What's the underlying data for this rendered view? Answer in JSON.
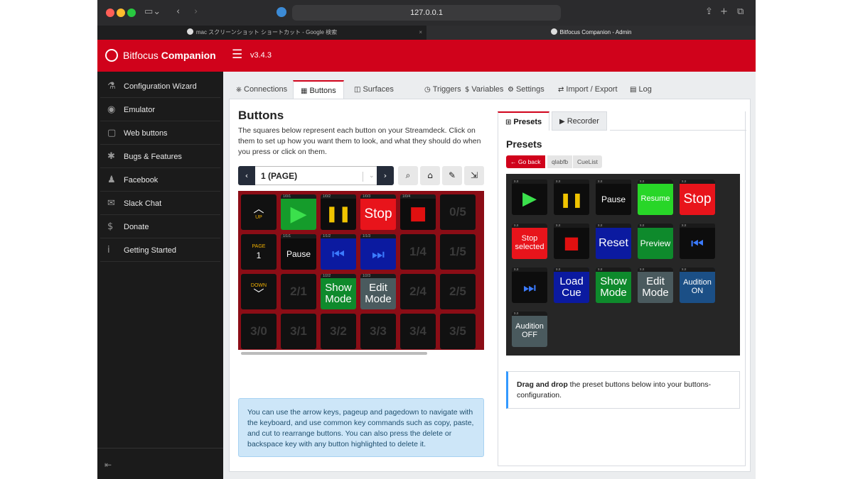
{
  "browser": {
    "address": "127.0.0.1",
    "tabs": [
      {
        "label": "mac スクリーンショット ショートカット - Google 検索",
        "active": false
      },
      {
        "label": "Bitfocus Companion - Admin",
        "active": true
      }
    ]
  },
  "app": {
    "brand_a": "Bitfocus",
    "brand_b": "Companion",
    "version": "v3.4.3"
  },
  "sidebar": {
    "items": [
      {
        "label": "Configuration Wizard",
        "icon": "wizard-hat-icon",
        "glyph": "⚗"
      },
      {
        "label": "Emulator",
        "icon": "gamepad-icon",
        "glyph": "◉"
      },
      {
        "label": "Web buttons",
        "icon": "tablet-icon",
        "glyph": "▢"
      },
      {
        "label": "Bugs & Features",
        "icon": "bug-icon",
        "glyph": "✱"
      },
      {
        "label": "Facebook",
        "icon": "users-icon",
        "glyph": "♟"
      },
      {
        "label": "Slack Chat",
        "icon": "comments-icon",
        "glyph": "✉"
      },
      {
        "label": "Donate",
        "icon": "dollar-icon",
        "glyph": "$"
      },
      {
        "label": "Getting Started",
        "icon": "info-icon",
        "glyph": "i"
      }
    ]
  },
  "tabs": [
    {
      "label": "Connections",
      "glyph": "⎈",
      "active": false
    },
    {
      "label": "Buttons",
      "glyph": "▦",
      "active": true
    },
    {
      "label": "Surfaces",
      "glyph": "◫",
      "active": false
    },
    {
      "label": "Triggers",
      "glyph": "◷",
      "active": false
    },
    {
      "label": "Variables",
      "glyph": "$",
      "active": false
    },
    {
      "label": "Settings",
      "glyph": "⚙",
      "active": false
    },
    {
      "label": "Import / Export",
      "glyph": "⇄",
      "active": false
    },
    {
      "label": "Log",
      "glyph": "▤",
      "active": false
    }
  ],
  "buttons": {
    "title": "Buttons",
    "description": "The squares below represent each button on your Streamdeck. Click on them to set up how you want them to look, and what they should do when you press or click on them.",
    "page_label": "1 (PAGE)",
    "help": "You can use the arrow keys, pageup and pagedown to navigate with the keyboard, and use common key commands such as copy, paste, and cut to rearrange buttons. You can also press the delete or backspace key with any button highlighted to delete it.",
    "grid": [
      [
        {
          "type": "nav",
          "label": "UP",
          "arrow": "︿"
        },
        {
          "header": "1/0/1",
          "label": "▶",
          "kind": "play",
          "bg": "#159c2b",
          "fg": "#3be04c"
        },
        {
          "header": "1/0/2",
          "label": "❚❚",
          "kind": "pause",
          "bg": "#0d0d0d",
          "fg": "#f0c400"
        },
        {
          "header": "1/0/3",
          "label": "Stop",
          "kind": "text",
          "bg": "#e8141b",
          "fg": "#ffffff",
          "size": 19
        },
        {
          "header": "1/0/4",
          "label": "■",
          "kind": "square",
          "bg": "#0d0d0d",
          "fg": "#e01010"
        },
        {
          "label": "0/5",
          "kind": "empty"
        }
      ],
      [
        {
          "type": "nav",
          "label": "PAGE",
          "value": "1"
        },
        {
          "header": "1/1/1",
          "label": "Pause",
          "kind": "text",
          "bg": "#0d0d0d",
          "fg": "#ffffff",
          "size": 12
        },
        {
          "header": "1/1/2",
          "label": "⏮",
          "kind": "text",
          "bg": "#0b1aa0",
          "fg": "#3b7bff",
          "size": 20
        },
        {
          "header": "1/1/3",
          "label": "⏭",
          "kind": "text",
          "bg": "#0b1aa0",
          "fg": "#3b7bff",
          "size": 20
        },
        {
          "label": "1/4",
          "kind": "empty"
        },
        {
          "label": "1/5",
          "kind": "empty"
        }
      ],
      [
        {
          "type": "nav",
          "label": "DOWN",
          "arrow": "﹀"
        },
        {
          "label": "2/1",
          "kind": "empty"
        },
        {
          "header": "1/2/2",
          "label": "Show Mode",
          "kind": "text",
          "bg": "#0e8a2c",
          "fg": "#ffffff",
          "size": 15
        },
        {
          "header": "1/2/3",
          "label": "Edit Mode",
          "kind": "text",
          "bg": "#4a5a5e",
          "fg": "#ffffff",
          "size": 15
        },
        {
          "label": "2/4",
          "kind": "empty"
        },
        {
          "label": "2/5",
          "kind": "empty"
        }
      ],
      [
        {
          "label": "3/0",
          "kind": "empty"
        },
        {
          "label": "3/1",
          "kind": "empty"
        },
        {
          "label": "3/2",
          "kind": "empty"
        },
        {
          "label": "3/3",
          "kind": "empty"
        },
        {
          "label": "3/4",
          "kind": "empty"
        },
        {
          "label": "3/5",
          "kind": "empty"
        }
      ]
    ]
  },
  "presets": {
    "tabs": [
      {
        "label": "Presets",
        "glyph": "🎁",
        "active": true
      },
      {
        "label": "Recorder",
        "glyph": "▶",
        "active": false
      }
    ],
    "title": "Presets",
    "go_back": "Go back",
    "crumbs": [
      "qlabfb",
      "CueList"
    ],
    "buttons": [
      {
        "label": "▶",
        "bg": "#0d0d0d",
        "fg": "#3be04c",
        "size": 26
      },
      {
        "label": "❚❚",
        "bg": "#0d0d0d",
        "fg": "#f0c400",
        "size": 20
      },
      {
        "label": "Pause",
        "bg": "#0d0d0d",
        "fg": "#ffffff",
        "size": 12
      },
      {
        "label": "Resume",
        "bg": "#28d628",
        "fg": "#ffffff",
        "size": 11
      },
      {
        "label": "Stop",
        "bg": "#e8141b",
        "fg": "#ffffff",
        "size": 19
      },
      {
        "label": "Stop selected",
        "bg": "#e8141b",
        "fg": "#ffffff",
        "size": 11
      },
      {
        "label": "■",
        "bg": "#0d0d0d",
        "fg": "#e01010",
        "size": 24
      },
      {
        "label": "Reset",
        "bg": "#0b1aa0",
        "fg": "#ffffff",
        "size": 16
      },
      {
        "label": "Preview",
        "bg": "#0e8a2c",
        "fg": "#ffffff",
        "size": 12
      },
      {
        "label": "⏮",
        "bg": "#0d0d0d",
        "fg": "#3b7bff",
        "size": 20
      },
      {
        "label": "⏭",
        "bg": "#0d0d0d",
        "fg": "#3b7bff",
        "size": 20
      },
      {
        "label": "Load Cue",
        "bg": "#0b1aa0",
        "fg": "#ffffff",
        "size": 15
      },
      {
        "label": "Show Mode",
        "bg": "#0e8a2c",
        "fg": "#ffffff",
        "size": 15
      },
      {
        "label": "Edit Mode",
        "bg": "#4a5a5e",
        "fg": "#ffffff",
        "size": 15
      },
      {
        "label": "Audition ON",
        "bg": "#1b4f86",
        "fg": "#ffffff",
        "size": 11
      },
      {
        "label": "Audition OFF",
        "bg": "#4a5a5e",
        "fg": "#ffffff",
        "size": 11
      }
    ],
    "hint_bold": "Drag and drop",
    "hint_rest": " the preset buttons below into your buttons-configuration."
  }
}
